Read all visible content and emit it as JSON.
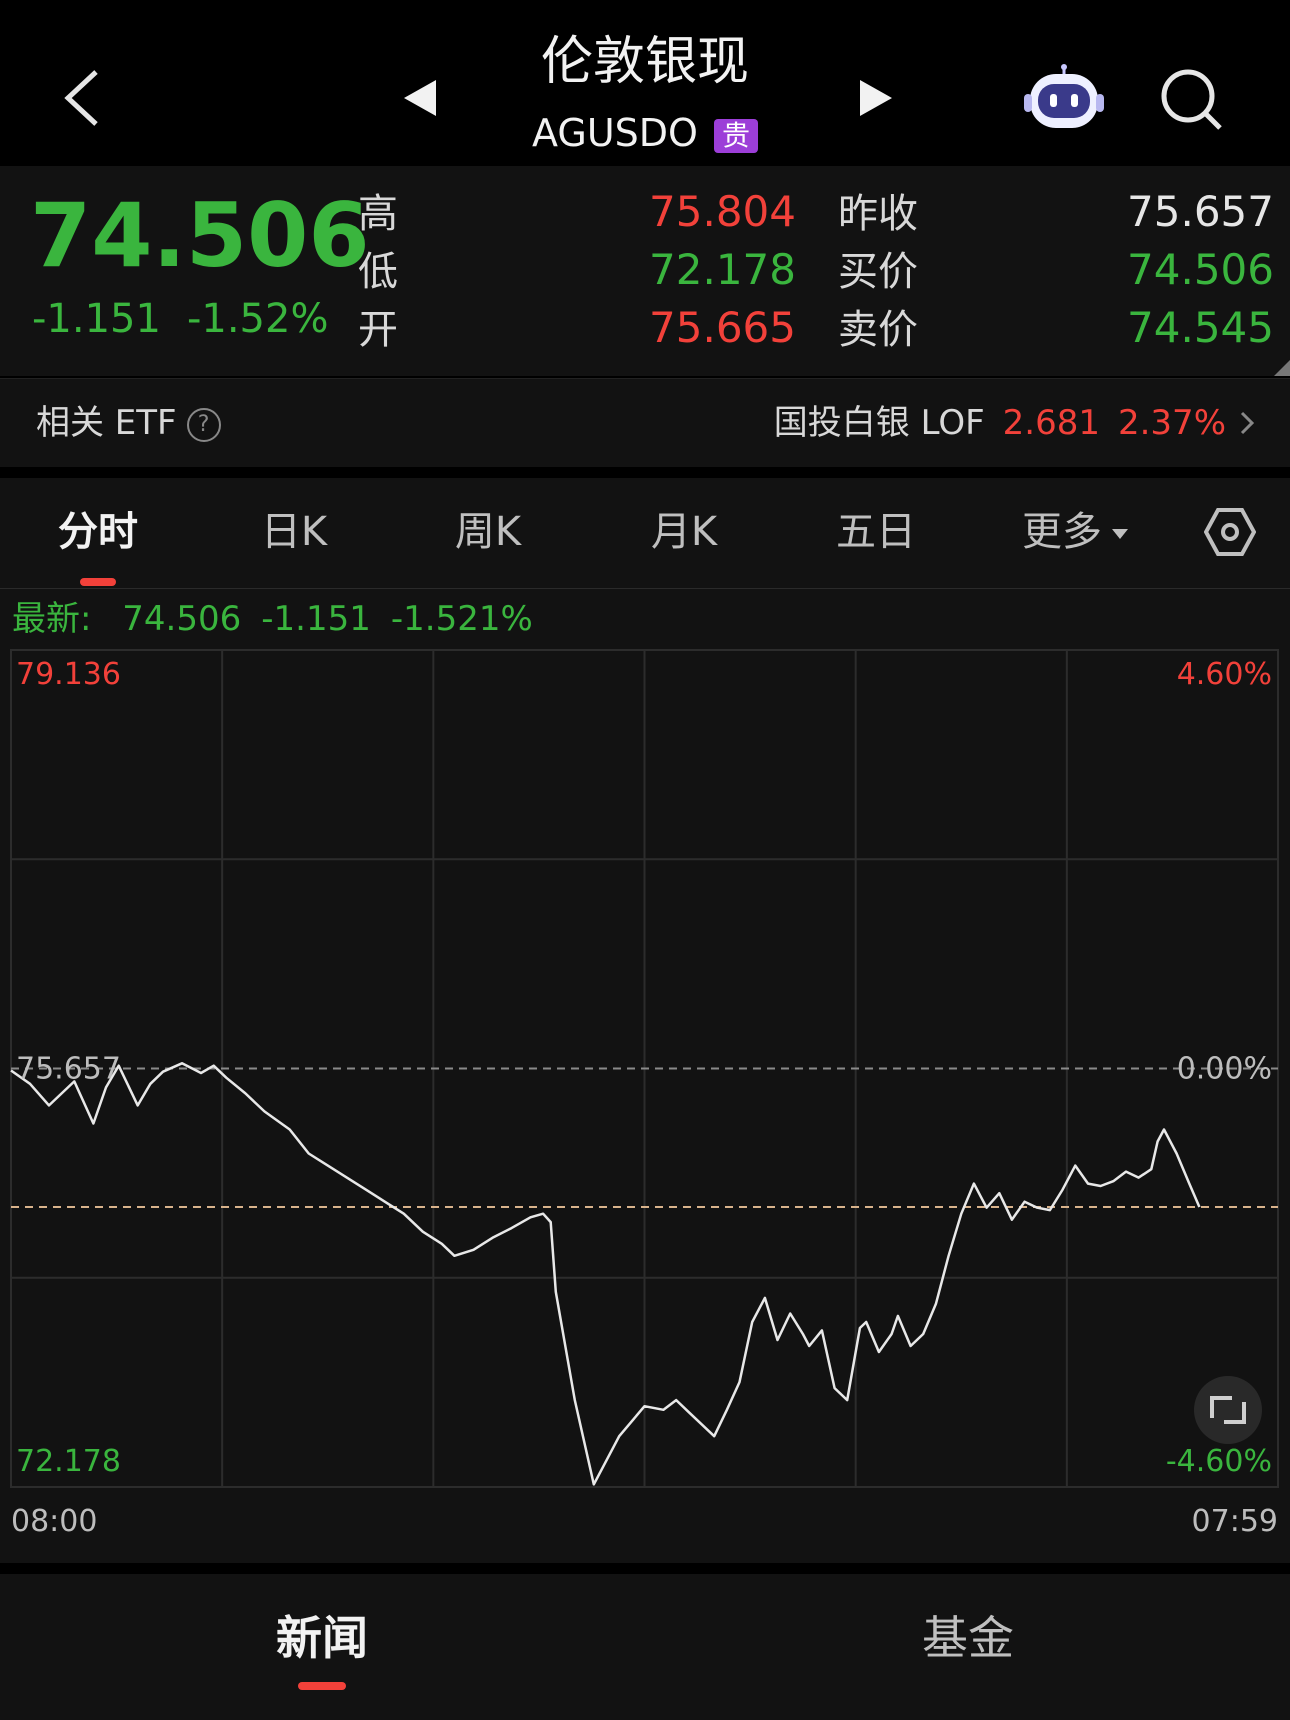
{
  "header": {
    "title": "伦敦银现",
    "symbol": "AGUSDO",
    "badge": "贵"
  },
  "quote": {
    "price": "74.506",
    "change": "-1.151",
    "change_pct": "-1.52%",
    "stats": [
      {
        "label": "高",
        "value": "75.804",
        "color": "red"
      },
      {
        "label": "低",
        "value": "72.178",
        "color": "green"
      },
      {
        "label": "开",
        "value": "75.665",
        "color": "red"
      },
      {
        "label": "昨收",
        "value": "75.657",
        "color": "white"
      },
      {
        "label": "买价",
        "value": "74.506",
        "color": "green"
      },
      {
        "label": "卖价",
        "value": "74.545",
        "color": "green"
      }
    ]
  },
  "etf": {
    "label": "相关 ETF",
    "help": "?",
    "name": "国投白银 LOF",
    "price": "2.681",
    "pct": "2.37%"
  },
  "tabs": [
    "分时",
    "日K",
    "周K",
    "月K",
    "五日",
    "更多"
  ],
  "latest": {
    "label": "最新:",
    "price": "74.506",
    "change": "-1.151",
    "pct": "-1.521%"
  },
  "colors": {
    "up": "#f2413a",
    "down": "#3ab53e",
    "line": "#e8e8e8",
    "ref_line": "#d9b38c"
  },
  "chart_data": {
    "type": "line",
    "ylim": [
      72.178,
      79.136
    ],
    "prev_close": 75.657,
    "current": 74.506,
    "left_ticks": [
      "79.136",
      "75.657",
      "72.178"
    ],
    "right_ticks": [
      "4.60%",
      "0.00%",
      "-4.60%"
    ],
    "x_labels": [
      "08:00",
      "07:59"
    ],
    "series": [
      {
        "x": [
          0,
          1.5,
          3,
          5,
          6.5,
          7.5,
          8.5,
          10,
          11,
          12,
          13.5,
          15,
          16,
          17,
          18.5,
          20,
          22,
          23.5,
          25,
          26.5,
          28,
          29.5,
          31,
          32.5,
          34,
          35,
          36.5,
          38,
          39.5,
          41,
          42,
          42.6,
          43,
          44.5,
          46,
          48,
          50,
          51.5,
          52.5,
          53.5,
          54.5,
          55.5,
          56.5,
          57.5,
          58.5,
          59.5,
          60.5,
          61.5,
          62.5,
          63,
          64,
          65,
          66,
          67,
          67.5,
          68.5,
          69.5,
          70,
          71,
          72,
          73,
          74,
          75,
          76,
          77,
          78,
          79,
          80,
          81,
          82,
          83,
          84,
          85,
          86,
          87,
          88,
          89,
          90,
          90.5,
          91,
          92,
          93,
          93.8
        ],
        "y": [
          75.64,
          75.53,
          75.35,
          75.55,
          75.2,
          75.5,
          75.68,
          75.35,
          75.53,
          75.63,
          75.7,
          75.62,
          75.68,
          75.58,
          75.45,
          75.3,
          75.15,
          74.95,
          74.85,
          74.75,
          74.65,
          74.55,
          74.45,
          74.3,
          74.2,
          74.1,
          74.15,
          74.25,
          74.33,
          74.42,
          74.45,
          74.38,
          73.8,
          72.9,
          72.2,
          72.6,
          72.85,
          72.82,
          72.9,
          72.8,
          72.7,
          72.6,
          72.82,
          73.05,
          73.55,
          73.75,
          73.4,
          73.62,
          73.45,
          73.35,
          73.48,
          73.0,
          72.9,
          73.5,
          73.55,
          73.3,
          73.45,
          73.6,
          73.35,
          73.45,
          73.7,
          74.1,
          74.45,
          74.7,
          74.5,
          74.62,
          74.4,
          74.55,
          74.5,
          74.48,
          74.65,
          74.85,
          74.7,
          74.68,
          74.72,
          74.8,
          74.75,
          74.82,
          75.05,
          75.15,
          74.95,
          74.7,
          74.506
        ]
      }
    ]
  },
  "bottom_tabs": [
    "新闻",
    "基金"
  ]
}
